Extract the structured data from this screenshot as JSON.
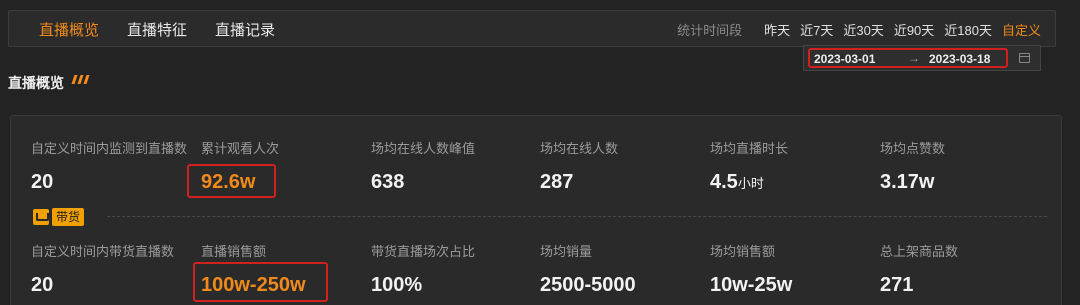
{
  "tabs": [
    {
      "label": "直播概览",
      "active": true
    },
    {
      "label": "直播特征",
      "active": false
    },
    {
      "label": "直播记录",
      "active": false
    }
  ],
  "period": {
    "label": "统计时间段",
    "options": [
      "昨天",
      "近7天",
      "近30天",
      "近90天",
      "近180天",
      "自定义"
    ],
    "active": "自定义"
  },
  "daterange": {
    "start": "2023-03-01",
    "arrow": "→",
    "end": "2023-03-18"
  },
  "section_title": "直播概览",
  "metrics_row1": [
    {
      "label": "自定义时间内监测到直播数",
      "value": "20",
      "unit": ""
    },
    {
      "label": "累计观看人次",
      "value": "92.6w",
      "unit": ""
    },
    {
      "label": "场均在线人数峰值",
      "value": "638",
      "unit": ""
    },
    {
      "label": "场均在线人数",
      "value": "287",
      "unit": ""
    },
    {
      "label": "场均直播时长",
      "value": "4.5",
      "unit": "小时"
    },
    {
      "label": "场均点赞数",
      "value": "3.17w",
      "unit": ""
    }
  ],
  "goods_badge": "带货",
  "metrics_row2": [
    {
      "label": "自定义时间内带货直播数",
      "value": "20",
      "unit": ""
    },
    {
      "label": "直播销售额",
      "value": "100w-250w",
      "unit": ""
    },
    {
      "label": "带货直播场次占比",
      "value": "100%",
      "unit": ""
    },
    {
      "label": "场均销量",
      "value": "2500-5000",
      "unit": ""
    },
    {
      "label": "场均销售额",
      "value": "10w-25w",
      "unit": ""
    },
    {
      "label": "总上架商品数",
      "value": "271",
      "unit": ""
    }
  ],
  "colors": {
    "accent": "#f08a1a",
    "highlight": "#d02020",
    "badge": "#f0a000",
    "background": "#232323"
  }
}
